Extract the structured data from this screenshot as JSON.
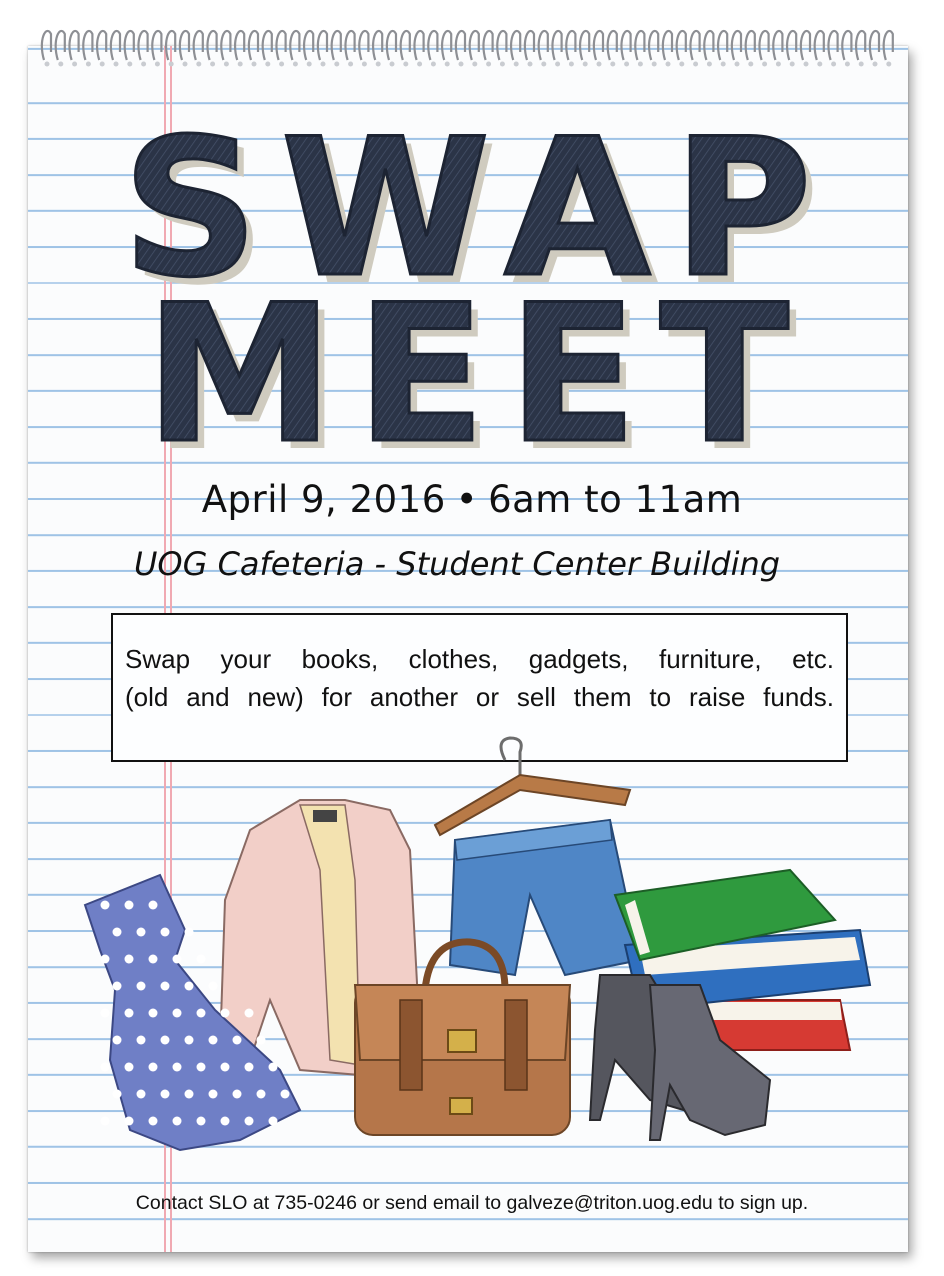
{
  "title": {
    "line1": "SWAP",
    "line2": "MEET"
  },
  "event": {
    "date": "April 9, 2016",
    "separator": "•",
    "time": "6am to 11am",
    "venue": "UOG Cafeteria - Student Center Building"
  },
  "description": {
    "line1": "Swap your books, clothes, gadgets, furniture, etc.",
    "line2": "(old and new) for another or sell them to raise funds."
  },
  "contact": "Contact SLO at 735-0246 or send email to galveze@triton.uog.edu to sign up.",
  "colors": {
    "title_fill": "#2b3447",
    "title_shadow": "#eae6da",
    "rule_lines": "#9fc3e6",
    "margin_lines": "#f0a9b2",
    "dress": "#6f7fc6",
    "blazer": "#f2cfc8",
    "shorts": "#4f86c6",
    "bag": "#b5764a",
    "shoes": "#55565e",
    "book_green": "#2f9a3e",
    "book_blue": "#2f6fbf",
    "book_red": "#d63a33"
  },
  "illustration_items": [
    "polka-dot-dress",
    "blazer",
    "denim-shorts-on-hanger",
    "leather-satchel",
    "high-heels",
    "stack-of-books"
  ]
}
